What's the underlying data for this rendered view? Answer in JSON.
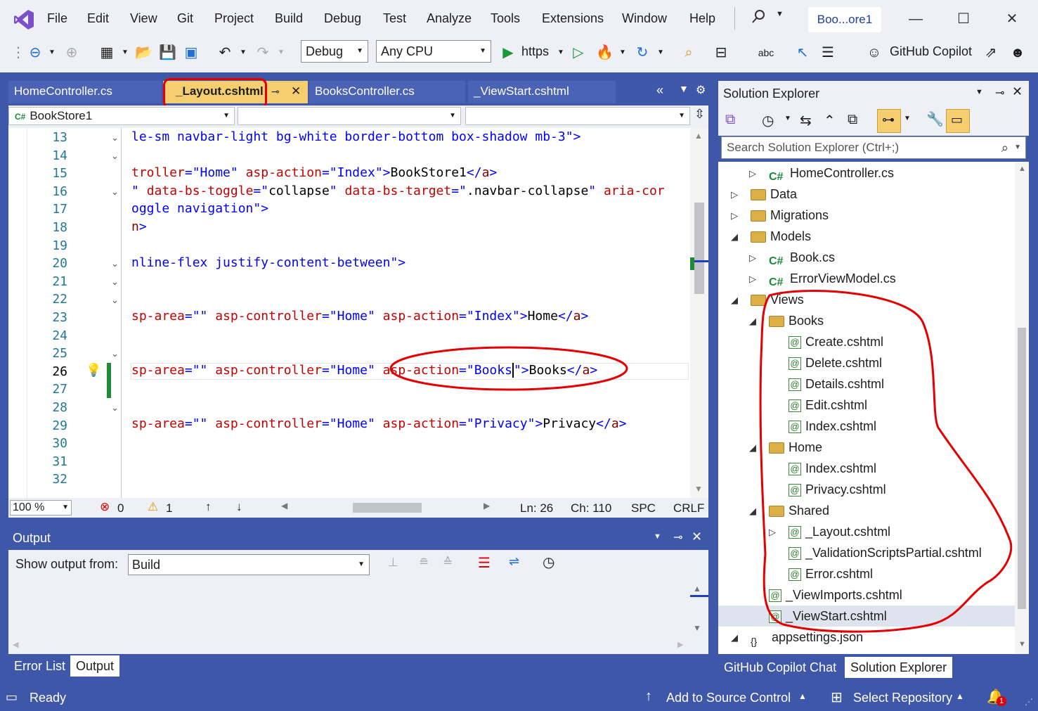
{
  "menu": {
    "items": [
      "File",
      "Edit",
      "View",
      "Git",
      "Project",
      "Build",
      "Debug",
      "Test",
      "Analyze",
      "Tools",
      "Extensions",
      "Window",
      "Help"
    ],
    "solution_title": "Boo...ore1"
  },
  "toolbar": {
    "config": "Debug",
    "platform": "Any CPU",
    "run_target": "https",
    "copilot": "GitHub Copilot"
  },
  "tabs": {
    "home_controller": "HomeController.cs",
    "layout": "_Layout.cshtml",
    "books_controller": "BooksController.cs",
    "viewstart": "_ViewStart.cshtml"
  },
  "navbar": {
    "project": "BookStore1"
  },
  "editor": {
    "lines": [
      "13",
      "14",
      "15",
      "16",
      "17",
      "18",
      "19",
      "20",
      "21",
      "22",
      "23",
      "24",
      "25",
      "26",
      "27",
      "28",
      "29",
      "30",
      "31",
      "32"
    ],
    "current_line": "26"
  },
  "edstatus": {
    "zoom": "100 %",
    "errors": "0",
    "warnings": "1",
    "ln": "Ln: 26",
    "ch": "Ch: 110",
    "spc": "SPC",
    "crlf": "CRLF"
  },
  "output": {
    "title": "Output",
    "show_from_label": "Show output from:",
    "source": "Build"
  },
  "bottom_tabs": {
    "error_list": "Error List",
    "output": "Output"
  },
  "solution_explorer": {
    "title": "Solution Explorer",
    "search_placeholder": "Search Solution Explorer (Ctrl+;)",
    "tree": [
      {
        "label": "HomeController.cs",
        "type": "cs"
      },
      {
        "label": "Data",
        "type": "folder"
      },
      {
        "label": "Migrations",
        "type": "folder"
      },
      {
        "label": "Models",
        "type": "folder"
      },
      {
        "label": "Book.cs",
        "type": "cs"
      },
      {
        "label": "ErrorViewModel.cs",
        "type": "cs"
      },
      {
        "label": "Views",
        "type": "folder"
      },
      {
        "label": "Books",
        "type": "folder"
      },
      {
        "label": "Create.cshtml",
        "type": "razor"
      },
      {
        "label": "Delete.cshtml",
        "type": "razor"
      },
      {
        "label": "Details.cshtml",
        "type": "razor"
      },
      {
        "label": "Edit.cshtml",
        "type": "razor"
      },
      {
        "label": "Index.cshtml",
        "type": "razor"
      },
      {
        "label": "Home",
        "type": "folder"
      },
      {
        "label": "Index.cshtml",
        "type": "razor"
      },
      {
        "label": "Privacy.cshtml",
        "type": "razor"
      },
      {
        "label": "Shared",
        "type": "folder"
      },
      {
        "label": "_Layout.cshtml",
        "type": "razor"
      },
      {
        "label": "_ValidationScriptsPartial.cshtml",
        "type": "razor"
      },
      {
        "label": "Error.cshtml",
        "type": "razor"
      },
      {
        "label": "_ViewImports.cshtml",
        "type": "razor"
      },
      {
        "label": "_ViewStart.cshtml",
        "type": "razor"
      },
      {
        "label": "appsettings.json",
        "type": "json"
      }
    ],
    "bottom_tabs": {
      "copilot_chat": "GitHub Copilot Chat",
      "solution_explorer": "Solution Explorer"
    }
  },
  "status": {
    "ready": "Ready",
    "source_control": "Add to Source Control",
    "repository": "Select Repository",
    "notifications": "1"
  }
}
